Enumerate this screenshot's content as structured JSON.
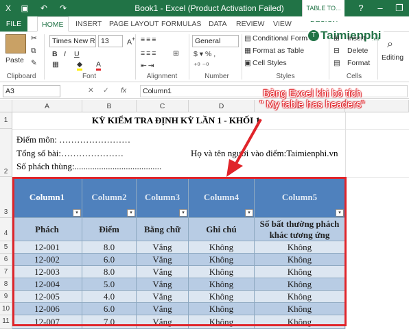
{
  "window": {
    "title": "Book1 -  Excel (Product Activation Failed)",
    "context_tab": "TABLE TO..."
  },
  "tabs": [
    "FILE",
    "HOME",
    "INSERT",
    "PAGE LAYOUT",
    "FORMULAS",
    "DATA",
    "REVIEW",
    "VIEW",
    "DESIGN"
  ],
  "ribbon": {
    "paste": "Paste",
    "clipboard": "Clipboard",
    "font_name": "Times New R",
    "font_size": "13",
    "font": "Font",
    "alignment": "Alignment",
    "number_format": "General",
    "number": "Number",
    "conditional": "Conditional Forma",
    "format_as_table": "Format as Table",
    "cell_styles": "Cell Styles",
    "styles": "Styles",
    "insert": "Insert",
    "delete": "Delete",
    "format": "Format",
    "cells": "Cells",
    "editing": "Editing"
  },
  "formula_bar": {
    "name_box": "A3",
    "fx": "fx",
    "content": "Column1"
  },
  "logo": {
    "text": "Taimienphi",
    "suffix": ".vn"
  },
  "columns": [
    "A",
    "B",
    "C",
    "D",
    "E"
  ],
  "rows": [
    "1",
    "2",
    "3",
    "4",
    "5",
    "6",
    "7",
    "8",
    "9",
    "10",
    "11"
  ],
  "sheet": {
    "title": "KỲ KIỂM TRA ĐỊNH KỲ LẦN 1  - KHỐI 1",
    "subject": "Điểm môn: ……………………",
    "total": "Tổng số bài:…………………",
    "code": "Số phách thùng:.......................................",
    "grader": "Họ và tên người vào điểm:Taimienphi.vn"
  },
  "table": {
    "headers": [
      "Column1",
      "Column2",
      "Column3",
      "Column4",
      "Column5"
    ],
    "subheaders": [
      "Phách",
      "Điểm",
      "Bằng chữ",
      "Ghi chú",
      "Số bất thường phách khác tương ứng"
    ],
    "rows": [
      [
        "12-001",
        "8.0",
        "Vắng",
        "Không",
        "Không"
      ],
      [
        "12-002",
        "6.0",
        "Vắng",
        "Không",
        "Không"
      ],
      [
        "12-003",
        "8.0",
        "Vắng",
        "Không",
        "Không"
      ],
      [
        "12-004",
        "5.0",
        "Vắng",
        "Không",
        "Không"
      ],
      [
        "12-005",
        "4.0",
        "Vắng",
        "Không",
        "Không"
      ],
      [
        "12-006",
        "6.0",
        "Vắng",
        "Không",
        "Không"
      ],
      [
        "12-007",
        "7.0",
        "Vắng",
        "Không",
        "Không"
      ]
    ]
  },
  "annotation": {
    "line1": "Bảng Excel khi bỏ tích",
    "line2": "\" My table has headers\""
  },
  "colors": {
    "excel_green": "#217346",
    "table_header": "#4f81bd",
    "band_light": "#dce6f1",
    "band_dark": "#b8cce4",
    "callout_red": "#e0242a"
  }
}
